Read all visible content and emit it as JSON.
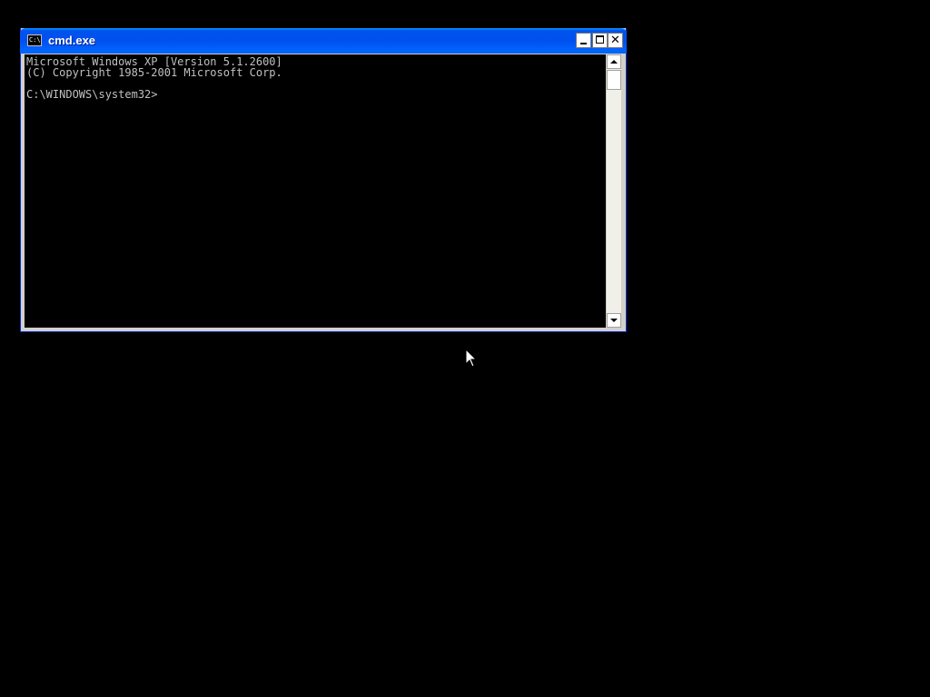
{
  "window": {
    "title": "cmd.exe",
    "icon": "console-icon",
    "icon_glyph": "C:\\",
    "controls": {
      "minimize": "minimize-icon",
      "maximize": "maximize-icon",
      "close": "close-icon",
      "close_glyph": "✕"
    }
  },
  "console": {
    "lines": [
      "Microsoft Windows XP [Version 5.1.2600]",
      "(C) Copyright 1985-2001 Microsoft Corp.",
      "",
      "C:\\WINDOWS\\system32>"
    ],
    "text_color": "#c0c0c0",
    "background_color": "#000000"
  },
  "colors": {
    "titlebar": "#0050ee",
    "desktop": "#000000"
  }
}
